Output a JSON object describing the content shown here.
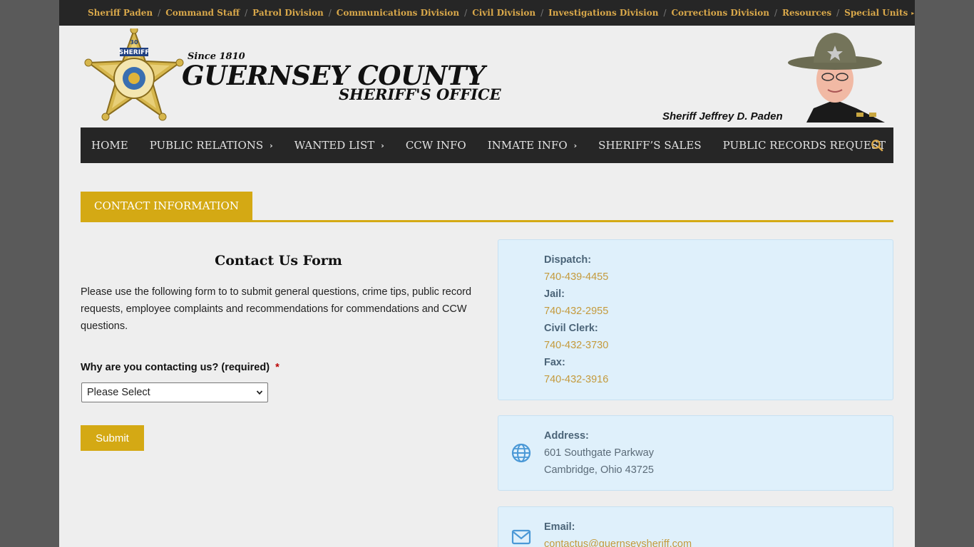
{
  "top_nav": {
    "items": [
      "Sheriff Paden",
      "Command Staff",
      "Patrol Division",
      "Communications Division",
      "Civil Division",
      "Investigations Division",
      "Corrections Division",
      "Resources",
      "Special Units"
    ],
    "separator": "/"
  },
  "header": {
    "since": "Since 1810",
    "title": "GUERNSEY COUNTY",
    "subtitle": "SHERIFF'S OFFICE",
    "sheriff_caption": "Sheriff Jeffrey D. Paden",
    "badge_text": {
      "top": "SHERIFF",
      "number": "30",
      "name": "JEFFREY D. PADEN",
      "county": "GUERNSEY COUNTY"
    }
  },
  "main_nav": {
    "items": [
      {
        "label": "HOME",
        "has_submenu": false
      },
      {
        "label": "PUBLIC RELATIONS",
        "has_submenu": true
      },
      {
        "label": "WANTED LIST",
        "has_submenu": true
      },
      {
        "label": "CCW INFO",
        "has_submenu": false
      },
      {
        "label": "INMATE INFO",
        "has_submenu": true
      },
      {
        "label": "SHERIFF’S SALES",
        "has_submenu": false
      },
      {
        "label": "PUBLIC RECORDS REQUEST",
        "has_submenu": false
      }
    ],
    "search_icon": "search-icon"
  },
  "section": {
    "tab_label": "CONTACT INFORMATION"
  },
  "form": {
    "title": "Contact Us Form",
    "intro": "Please use the following form to to submit general questions, crime tips, public record requests, employee complaints and recommendations for commendations and CCW questions.",
    "question_label": "Why are you contacting us? (required)",
    "required_mark": "*",
    "select_value": "Please Select",
    "submit_label": "Submit"
  },
  "contact": {
    "phones": [
      {
        "label": "Dispatch:",
        "value": "740-439-4455"
      },
      {
        "label": "Jail:",
        "value": "740-432-2955"
      },
      {
        "label": "Civil Clerk:",
        "value": "740-432-3730"
      },
      {
        "label": "Fax:",
        "value": "740-432-3916"
      }
    ],
    "address": {
      "label": "Address:",
      "line1": "601 Southgate Parkway",
      "line2": "Cambridge, Ohio 43725",
      "icon": "globe-icon"
    },
    "email": {
      "label": "Email:",
      "value": "contactus@guernseysheriff.com",
      "icon": "envelope-icon"
    }
  },
  "colors": {
    "gold": "#d4a914",
    "dark": "#262626",
    "link_gold": "#c49a3c",
    "card_bg": "#dff0fb"
  }
}
